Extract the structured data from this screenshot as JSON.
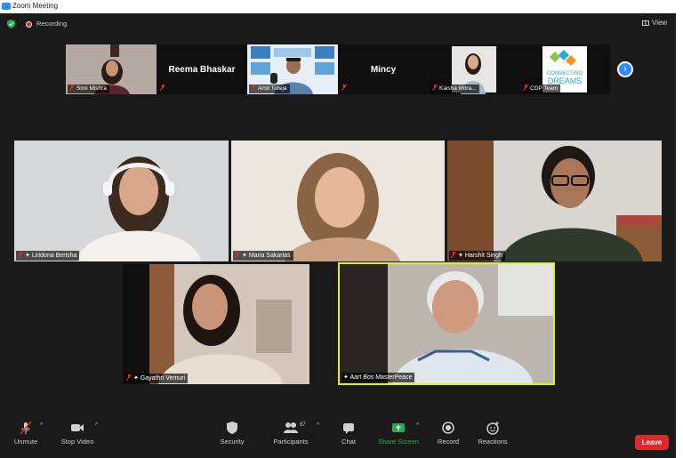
{
  "window": {
    "title": "Zoom Meeting"
  },
  "topbar": {
    "recording_label": "Recording",
    "view_label": "View"
  },
  "strip": {
    "participants": [
      {
        "name": "Simi Mishra",
        "has_video": true
      },
      {
        "name": "Reema Bhaskar",
        "has_video": false
      },
      {
        "name": "Amit Tuteja",
        "has_video": true
      },
      {
        "name": "Mincy",
        "has_video": false
      },
      {
        "name": "Kaisha Mitra...",
        "has_video": true
      },
      {
        "name": "CDP Team",
        "has_video": true,
        "logo_text": "CONNECTING DREAMS"
      }
    ]
  },
  "gallery": {
    "tiles": [
      {
        "name": "Liridona Berisha"
      },
      {
        "name": "Maria Sakarias"
      },
      {
        "name": "Harshit Singh"
      },
      {
        "name": "Gayathri Vemuri"
      },
      {
        "name": "Aart Bos MasterPeace",
        "active_speaker": true
      }
    ]
  },
  "toolbar": {
    "unmute": "Unmute",
    "stop_video": "Stop Video",
    "security": "Security",
    "participants": "Participants",
    "participants_count": "87",
    "chat": "Chat",
    "share_screen": "Share Screen",
    "record": "Record",
    "reactions": "Reactions",
    "leave": "Leave"
  },
  "colors": {
    "background": "#1a1a1a",
    "accent_blue": "#2d8cff",
    "recording_red": "#e02828",
    "share_green": "#21b14b",
    "active_speaker_outline": "#d9f218"
  }
}
